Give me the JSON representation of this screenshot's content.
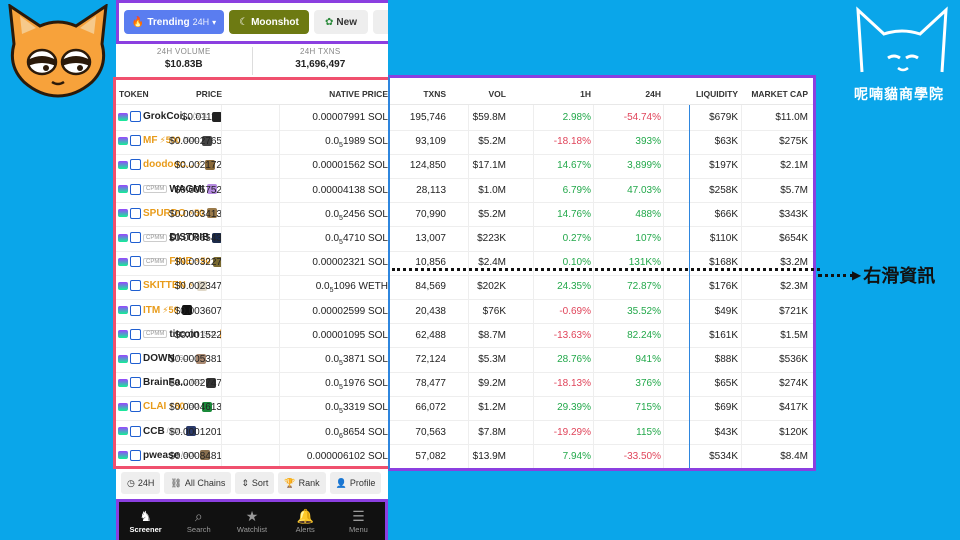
{
  "topbar": {
    "trending_label": "Trending",
    "trending_period": "24H",
    "moonshot_label": "Moonshot",
    "new_label": "New"
  },
  "stats": {
    "volume_label": "24H VOLUME",
    "volume_value": "$10.83B",
    "txns_label": "24H TXNS",
    "txns_value": "31,696,497"
  },
  "table": {
    "headers": {
      "token": "TOKEN",
      "price": "PRICE",
      "native": "NATIVE PRICE",
      "txns": "TXNS",
      "vol": "VOL",
      "h1": "1H",
      "h24": "24H",
      "liquidity": "LIQUIDITY",
      "mcap": "MARKET CAP"
    },
    "rows": [
      {
        "symbol": "GrokCoi...",
        "boost": "",
        "cpmm": false,
        "quote": "/SOL",
        "price": "$0.01110",
        "native_pre": "0.00007991 SOL",
        "native_sub": "",
        "native_post": "",
        "txns": "195,746",
        "vol": "$59.8M",
        "h1": "2.98%",
        "h1_sign": "pos",
        "h24": "-54.74%",
        "h24_sign": "neg",
        "liq": "$679K",
        "mcap": "$11.0M",
        "icon": "#222"
      },
      {
        "symbol": "MF",
        "boost": "⚡500",
        "cpmm": false,
        "quote": "/SOL",
        "price": "$0.0002765",
        "native_pre": "0.0",
        "native_sub": "5",
        "native_post": "1989 SOL",
        "txns": "93,109",
        "vol": "$5.2M",
        "h1": "-18.18%",
        "h1_sign": "neg",
        "h24": "393%",
        "h24_sign": "pos",
        "liq": "$63K",
        "mcap": "$275K",
        "icon": "#444"
      },
      {
        "symbol": "doodooc...",
        "boost": "⚡",
        "cpmm": false,
        "quote": "",
        "price": "$0.002172",
        "native_pre": "0.00001562 SOL",
        "native_sub": "",
        "native_post": "",
        "txns": "124,850",
        "vol": "$17.1M",
        "h1": "14.67%",
        "h1_sign": "pos",
        "h24": "3,899%",
        "h24_sign": "pos",
        "liq": "$197K",
        "mcap": "$2.1M",
        "icon": "#8a6a3a"
      },
      {
        "symbol": "WAGMI",
        "boost": "",
        "cpmm": true,
        "quote": "",
        "price": "$0.005752",
        "native_pre": "0.00004138 SOL",
        "native_sub": "",
        "native_post": "",
        "txns": "28,113",
        "vol": "$1.0M",
        "h1": "6.79%",
        "h1_sign": "pos",
        "h24": "47.03%",
        "h24_sign": "pos",
        "liq": "$258K",
        "mcap": "$5.7M",
        "icon": "#b58ae0"
      },
      {
        "symbol": "SPURDO",
        "boost": "⚡50",
        "cpmm": false,
        "quote": "",
        "price": "$0.0003413",
        "native_pre": "0.0",
        "native_sub": "5",
        "native_post": "2456 SOL",
        "txns": "70,990",
        "vol": "$5.2M",
        "h1": "14.76%",
        "h1_sign": "pos",
        "h24": "488%",
        "h24_sign": "pos",
        "liq": "$66K",
        "mcap": "$343K",
        "icon": "#9a7a4a"
      },
      {
        "symbol": "DISTRIB",
        "boost": "",
        "cpmm": true,
        "quote": "",
        "price": "$0.0006543",
        "native_pre": "0.0",
        "native_sub": "5",
        "native_post": "4710 SOL",
        "txns": "13,007",
        "vol": "$223K",
        "h1": "0.27%",
        "h1_sign": "pos",
        "h24": "107%",
        "h24_sign": "pos",
        "liq": "$110K",
        "mcap": "$654K",
        "icon": "#1b2a4a"
      },
      {
        "symbol": "FINE",
        "boost": "⚡50",
        "cpmm": true,
        "quote": "",
        "price": "$0.003227",
        "native_pre": "0.00002321 SOL",
        "native_sub": "",
        "native_post": "",
        "txns": "10,856",
        "vol": "$2.4M",
        "h1": "0.10%",
        "h1_sign": "pos",
        "h24": "131K%",
        "h24_sign": "pos",
        "liq": "$168K",
        "mcap": "$3.2M",
        "icon": "#7a6a30"
      },
      {
        "symbol": "SKITTEN",
        "boost": "⚡",
        "cpmm": false,
        "quote": "",
        "price": "$0.002347",
        "native_pre": "0.0",
        "native_sub": "5",
        "native_post": "1096 WETH",
        "txns": "84,569",
        "vol": "$202K",
        "h1": "24.35%",
        "h1_sign": "pos",
        "h24": "72.87%",
        "h24_sign": "pos",
        "liq": "$176K",
        "mcap": "$2.3M",
        "icon": "#e0d8c8"
      },
      {
        "symbol": "ITM",
        "boost": "⚡50",
        "cpmm": false,
        "quote": "",
        "price": "$0.003607",
        "native_pre": "0.00002599 SOL",
        "native_sub": "",
        "native_post": "",
        "txns": "20,438",
        "vol": "$76K",
        "h1": "-0.69%",
        "h1_sign": "neg",
        "h24": "35.52%",
        "h24_sign": "pos",
        "liq": "$49K",
        "mcap": "$721K",
        "icon": "#111"
      },
      {
        "symbol": "titcoin",
        "boost": "",
        "cpmm": true,
        "quote": "/SOL",
        "price": "$0.001522",
        "native_pre": "0.00001095 SOL",
        "native_sub": "",
        "native_post": "",
        "txns": "62,488",
        "vol": "$8.7M",
        "h1": "-13.63%",
        "h1_sign": "neg",
        "h24": "82.24%",
        "h24_sign": "pos",
        "liq": "$161K",
        "mcap": "$1.5M",
        "icon": "#e8a040"
      },
      {
        "symbol": "DOWN",
        "boost": "",
        "cpmm": false,
        "quote": "/SOL",
        "price": "$0.0005381",
        "native_pre": "0.0",
        "native_sub": "5",
        "native_post": "3871 SOL",
        "txns": "72,124",
        "vol": "$5.3M",
        "h1": "28.76%",
        "h1_sign": "pos",
        "h24": "941%",
        "h24_sign": "pos",
        "liq": "$88K",
        "mcap": "$536K",
        "icon": "#a88870"
      },
      {
        "symbol": "BrainFa...",
        "boost": "",
        "cpmm": false,
        "quote": "/SO",
        "price": "$0.0002747",
        "native_pre": "0.0",
        "native_sub": "5",
        "native_post": "1976 SOL",
        "txns": "78,477",
        "vol": "$9.2M",
        "h1": "-18.13%",
        "h1_sign": "neg",
        "h24": "376%",
        "h24_sign": "pos",
        "liq": "$65K",
        "mcap": "$274K",
        "icon": "#333"
      },
      {
        "symbol": "CLAI",
        "boost": "⚡80",
        "cpmm": false,
        "quote": "/SO",
        "price": "$0.0004613",
        "native_pre": "0.0",
        "native_sub": "5",
        "native_post": "3319 SOL",
        "txns": "66,072",
        "vol": "$1.2M",
        "h1": "29.39%",
        "h1_sign": "pos",
        "h24": "715%",
        "h24_sign": "pos",
        "liq": "$69K",
        "mcap": "$417K",
        "icon": "#1a8a3a"
      },
      {
        "symbol": "CCB",
        "boost": "",
        "cpmm": false,
        "quote": "/SOL",
        "price": "$0.0001201",
        "native_pre": "0.0",
        "native_sub": "6",
        "native_post": "8654 SOL",
        "txns": "70,563",
        "vol": "$7.8M",
        "h1": "-19.29%",
        "h1_sign": "neg",
        "h24": "115%",
        "h24_sign": "pos",
        "liq": "$43K",
        "mcap": "$120K",
        "icon": "#2a3a6a"
      },
      {
        "symbol": "pwease",
        "boost": "",
        "cpmm": false,
        "quote": "/SOL",
        "price": "$0.0008481",
        "native_pre": "0.000006102 SOL",
        "native_sub": "",
        "native_post": "",
        "txns": "57,082",
        "vol": "$13.9M",
        "h1": "7.94%",
        "h1_sign": "pos",
        "h24": "-33.50%",
        "h24_sign": "neg",
        "liq": "$534K",
        "mcap": "$8.4M",
        "icon": "#8a7050"
      }
    ]
  },
  "filters": {
    "period": "24H",
    "chains": "All Chains",
    "sort": "Sort",
    "rank": "Rank",
    "profile": "Profile"
  },
  "nav": {
    "screener": "Screener",
    "search": "Search",
    "watchlist": "Watchlist",
    "alerts": "Alerts",
    "menu": "Menu"
  },
  "brand": {
    "name": "呢喃貓商學院"
  },
  "annotation": {
    "text": "右滑資訊"
  },
  "colors": {
    "background": "#0aa6ea",
    "positive": "#22a84a",
    "negative": "#e0445a",
    "trending": "#5a7df0",
    "moonshot": "#6d7a12"
  }
}
